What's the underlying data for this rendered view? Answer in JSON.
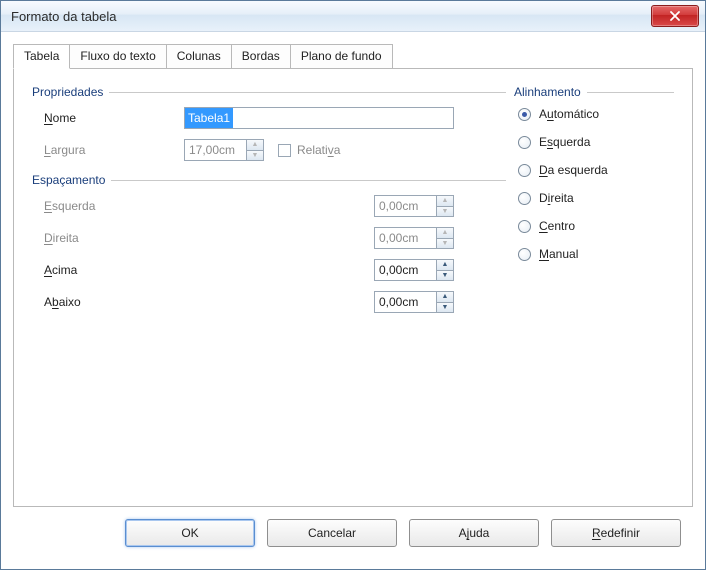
{
  "window": {
    "title": "Formato da tabela"
  },
  "tabs": [
    "Tabela",
    "Fluxo do texto",
    "Colunas",
    "Bordas",
    "Plano de fundo"
  ],
  "active_tab": 0,
  "propriedades": {
    "header": "Propriedades",
    "nome_label_pre": "",
    "nome_label_u": "N",
    "nome_label_post": "ome",
    "nome_value": "Tabela1",
    "largura_label_pre": "",
    "largura_label_u": "L",
    "largura_label_post": "argura",
    "largura_value": "17,00cm",
    "relativa_label_pre": "Relati",
    "relativa_label_u": "v",
    "relativa_label_post": "a"
  },
  "espacamento": {
    "header": "Espaçamento",
    "rows": [
      {
        "pre": "",
        "u": "E",
        "post": "squerda",
        "value": "0,00cm",
        "disabled": true
      },
      {
        "pre": "",
        "u": "D",
        "post": "ireita",
        "value": "0,00cm",
        "disabled": true
      },
      {
        "pre": "",
        "u": "A",
        "post": "cima",
        "value": "0,00cm",
        "disabled": false
      },
      {
        "pre": "A",
        "u": "b",
        "post": "aixo",
        "value": "0,00cm",
        "disabled": false
      }
    ]
  },
  "alinhamento": {
    "header": "Alinhamento",
    "options": [
      {
        "pre": "A",
        "u": "u",
        "post": "tomático",
        "checked": true
      },
      {
        "pre": "E",
        "u": "s",
        "post": "querda",
        "checked": false
      },
      {
        "pre": "",
        "u": "D",
        "post": "a esquerda",
        "checked": false
      },
      {
        "pre": "D",
        "u": "i",
        "post": "reita",
        "checked": false
      },
      {
        "pre": "",
        "u": "C",
        "post": "entro",
        "checked": false
      },
      {
        "pre": "",
        "u": "M",
        "post": "anual",
        "checked": false
      }
    ]
  },
  "buttons": {
    "ok": "OK",
    "cancel": "Cancelar",
    "help_pre": "A",
    "help_u": "j",
    "help_post": "uda",
    "reset_pre": "",
    "reset_u": "R",
    "reset_post": "edefinir"
  }
}
